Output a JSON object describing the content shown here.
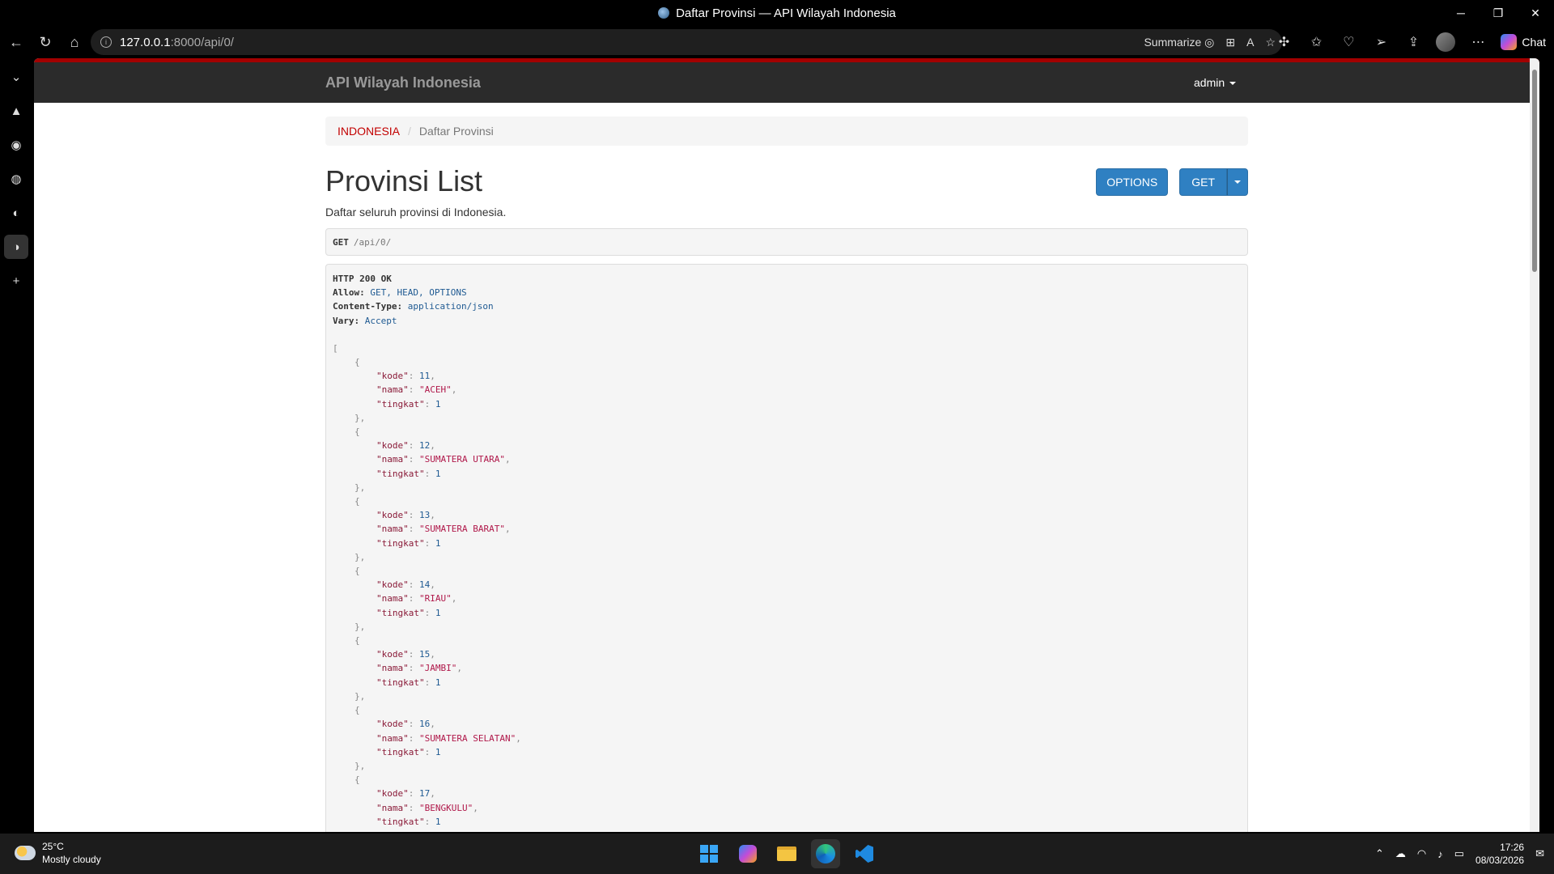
{
  "window": {
    "title": "Daftar Provinsi — API Wilayah Indonesia"
  },
  "browser": {
    "url_host": "127.0.0.1",
    "url_rest": ":8000/api/0/",
    "summarize_label": "Summarize",
    "chat_label": "Chat"
  },
  "navbar": {
    "brand": "API Wilayah Indonesia",
    "user": "admin"
  },
  "breadcrumb": {
    "root": "INDONESIA",
    "current": "Daftar Provinsi"
  },
  "page": {
    "title": "Provinsi List",
    "description": "Daftar seluruh provinsi di Indonesia.",
    "options_label": "OPTIONS",
    "get_label": "GET"
  },
  "request": {
    "method": "GET",
    "path": "/api/0/"
  },
  "response": {
    "status": "HTTP 200 OK",
    "headers": [
      {
        "name": "Allow:",
        "value": "GET, HEAD, OPTIONS"
      },
      {
        "name": "Content-Type:",
        "value": "application/json"
      },
      {
        "name": "Vary:",
        "value": "Accept"
      }
    ],
    "items": [
      {
        "kode": "11",
        "nama": "\"ACEH\"",
        "tingkat": "1"
      },
      {
        "kode": "12",
        "nama": "\"SUMATERA UTARA\"",
        "tingkat": "1"
      },
      {
        "kode": "13",
        "nama": "\"SUMATERA BARAT\"",
        "tingkat": "1"
      },
      {
        "kode": "14",
        "nama": "\"RIAU\"",
        "tingkat": "1"
      },
      {
        "kode": "15",
        "nama": "\"JAMBI\"",
        "tingkat": "1"
      },
      {
        "kode": "16",
        "nama": "\"SUMATERA SELATAN\"",
        "tingkat": "1"
      },
      {
        "kode": "17",
        "nama": "\"BENGKULU\"",
        "tingkat": "1"
      }
    ]
  },
  "taskbar": {
    "temperature": "25°C",
    "weather": "Mostly cloudy",
    "time": "17:26",
    "date": "08/03/2026"
  }
}
